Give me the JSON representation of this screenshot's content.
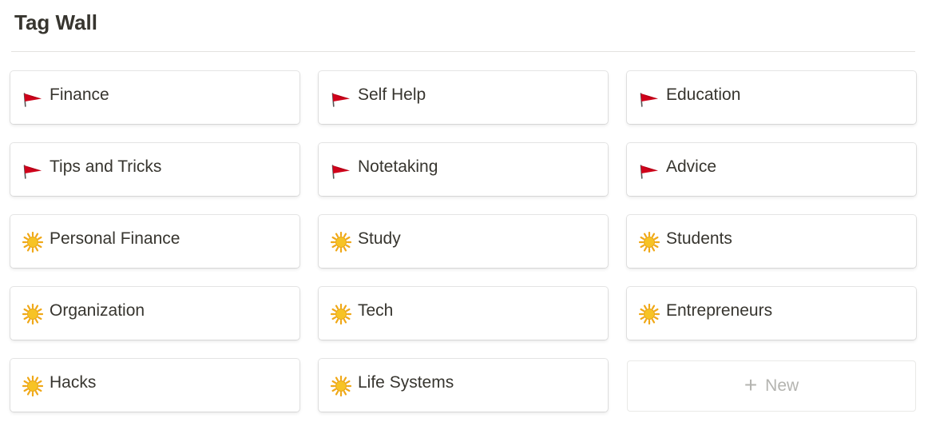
{
  "page": {
    "title": "Tag Wall"
  },
  "cards": [
    {
      "label": "Finance",
      "icon": "red-flag-icon"
    },
    {
      "label": "Self Help",
      "icon": "red-flag-icon"
    },
    {
      "label": "Education",
      "icon": "red-flag-icon"
    },
    {
      "label": "Tips and Tricks",
      "icon": "red-flag-icon"
    },
    {
      "label": "Notetaking",
      "icon": "red-flag-icon"
    },
    {
      "label": "Advice",
      "icon": "red-flag-icon"
    },
    {
      "label": "Personal Finance",
      "icon": "sun-icon"
    },
    {
      "label": "Study",
      "icon": "sun-icon"
    },
    {
      "label": "Students",
      "icon": "sun-icon"
    },
    {
      "label": "Organization",
      "icon": "sun-icon"
    },
    {
      "label": "Tech",
      "icon": "sun-icon"
    },
    {
      "label": "Entrepreneurs",
      "icon": "sun-icon"
    },
    {
      "label": "Hacks",
      "icon": "sun-icon"
    },
    {
      "label": "Life Systems",
      "icon": "sun-icon"
    }
  ],
  "new_button": {
    "label": "New",
    "icon": "plus-icon"
  },
  "colors": {
    "flag_red": "#d0021b",
    "sun_yellow": "#f7c325",
    "text": "#37352f",
    "muted": "#b4b4b0"
  }
}
